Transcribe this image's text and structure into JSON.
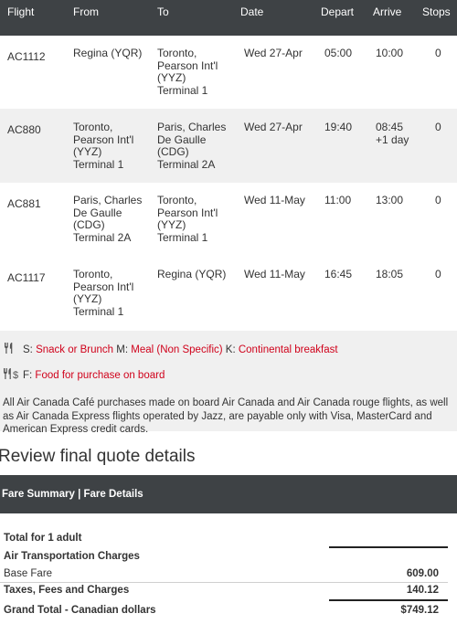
{
  "table": {
    "headers": {
      "flight": "Flight",
      "from": "From",
      "to": "To",
      "date": "Date",
      "depart": "Depart",
      "arrive": "Arrive",
      "stops": "Stops"
    },
    "rows": [
      {
        "flight": "AC1112",
        "from": "Regina (YQR)",
        "to": "Toronto,\nPearson Int'l\n(YYZ)\nTerminal 1",
        "date": "Wed 27-Apr",
        "depart": "05:00",
        "arrive": "10:00",
        "stops": "0"
      },
      {
        "flight": "AC880",
        "from": "Toronto,\nPearson Int'l\n(YYZ)\nTerminal 1",
        "to": "Paris, Charles\nDe Gaulle\n(CDG)\nTerminal 2A",
        "date": "Wed 27-Apr",
        "depart": "19:40",
        "arrive": "08:45\n+1 day",
        "stops": "0"
      },
      {
        "flight": "AC881",
        "from": "Paris, Charles\nDe Gaulle\n(CDG)\nTerminal 2A",
        "to": "Toronto,\nPearson Int'l\n(YYZ)\nTerminal 1",
        "date": "Wed 11-May",
        "depart": "11:00",
        "arrive": "13:00",
        "stops": "0"
      },
      {
        "flight": "AC1117",
        "from": "Toronto,\nPearson Int'l\n(YYZ)\nTerminal 1",
        "to": "Regina (YQR)",
        "date": "Wed 11-May",
        "depart": "16:45",
        "arrive": "18:05",
        "stops": "0"
      }
    ]
  },
  "meals": {
    "line1": {
      "s_code": "S: ",
      "s_text": "Snack or Brunch",
      "m_code": " M: ",
      "m_text": "Meal (Non Specific)",
      "k_code": " K: ",
      "k_text": "Continental breakfast"
    },
    "line2": {
      "f_code": "F: ",
      "f_text": "Food for purchase on board"
    },
    "icon1": "fork-knife-icon",
    "icon2": "fork-knife-dollar-icon",
    "disclaimer": "All Air Canada Café purchases made on board Air Canada and Air Canada rouge flights, as well as Air Canada Express flights operated by Jazz, are payable only with Visa, MasterCard and American Express credit cards."
  },
  "review": {
    "title": "Review final quote details",
    "fare_bar": "Fare Summary | Fare Details",
    "total_for": "Total for 1 adult",
    "air_charges": "Air Transportation Charges",
    "base_fare_label": "Base Fare",
    "base_fare_value": "609.00",
    "taxes_label": "Taxes, Fees and Charges",
    "taxes_value": "140.12",
    "grand_total_label": "Grand Total - Canadian dollars",
    "grand_total_value": "$749.12"
  },
  "colors": {
    "header_bg": "#3e4245",
    "meal_red": "#d0021b",
    "alt_row_bg": "#f0f0f0"
  }
}
